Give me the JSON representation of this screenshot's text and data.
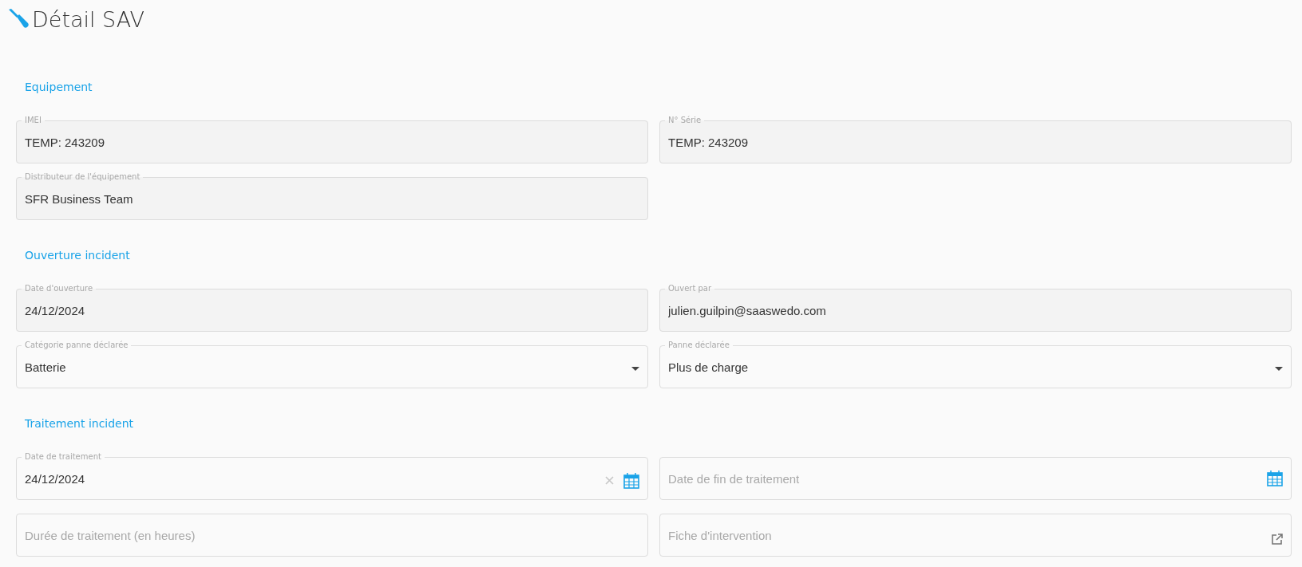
{
  "page": {
    "title": "Détail SAV"
  },
  "sections": [
    {
      "title": "Equipement",
      "fields": [
        {
          "kind": "readonly",
          "label": "IMEI",
          "value": "TEMP: 243209"
        },
        {
          "kind": "readonly",
          "label": "N° Série",
          "value": "TEMP: 243209"
        },
        {
          "kind": "readonly",
          "label": "Distributeur de l'équipement",
          "value": "SFR Business Team"
        }
      ]
    },
    {
      "title": "Ouverture incident",
      "fields": [
        {
          "kind": "readonly",
          "label": "Date d'ouverture",
          "value": "24/12/2024"
        },
        {
          "kind": "readonly",
          "label": "Ouvert par",
          "value": "julien.guilpin@saaswedo.com"
        },
        {
          "kind": "select",
          "label": "Catégorie panne déclarée",
          "value": "Batterie"
        },
        {
          "kind": "select",
          "label": "Panne déclarée",
          "value": "Plus de charge"
        }
      ]
    },
    {
      "title": "Traitement incident",
      "fields": [
        {
          "kind": "date",
          "label": "Date de traitement",
          "value": "24/12/2024"
        },
        {
          "kind": "date",
          "placeholder": "Date de fin de traitement"
        },
        {
          "kind": "text",
          "placeholder": "Durée de traitement (en heures)"
        },
        {
          "kind": "link",
          "placeholder": "Fiche d'intervention"
        }
      ]
    }
  ]
}
